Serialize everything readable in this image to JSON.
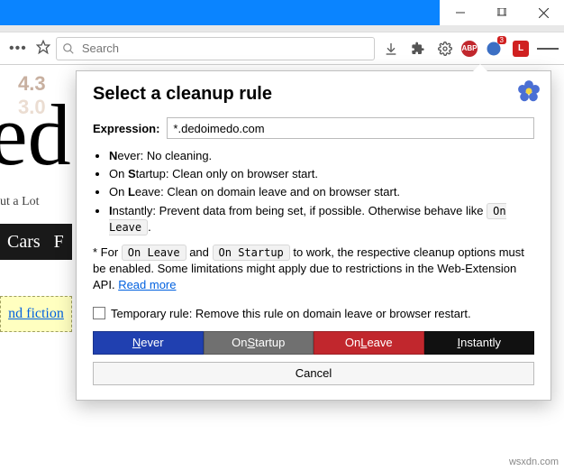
{
  "window": {
    "minimize": "–",
    "maximize": "❐",
    "close": "✕"
  },
  "toolbar": {
    "search_placeholder": "Search",
    "abp": "ABP",
    "notif_count": "3",
    "ext_l": "L"
  },
  "page": {
    "num1": "4.3",
    "num2": "3.0",
    "title_frag": "ed",
    "subtitle": "ut a Lot",
    "nav_cars": "Cars",
    "nav_f": "F",
    "link": "nd fiction"
  },
  "popup": {
    "title": "Select a cleanup rule",
    "expression_label": "Expression:",
    "expression_value": "*.dedoimedo.com",
    "items": {
      "never": "ever: No cleaning.",
      "startup": "tartup: Clean only on browser start.",
      "leave": "eave: Clean on domain leave and on browser start.",
      "instantly": "nstantly: Prevent data from being set, if possible. Otherwise behave like"
    },
    "code_onleave": "On Leave",
    "code_onstartup": "On Startup",
    "note_pre": "* For ",
    "note_mid": " and ",
    "note_post": " to work, the respective cleanup options must be enabled. Some limitations might apply due to restrictions in the Web-Extension API. ",
    "readmore": "Read more",
    "temporary": "Temporary rule: Remove this rule on domain leave or browser restart.",
    "btn_never": "ever",
    "btn_startup": "tartup",
    "btn_leave": "eave",
    "btn_instantly": "nstantly",
    "btn_never_u": "N",
    "btn_startup_pre": "On ",
    "btn_startup_u": "S",
    "btn_leave_pre": "On ",
    "btn_leave_u": "L",
    "btn_instantly_u": "I",
    "cancel": "Cancel"
  },
  "watermark": "wsxdn.com"
}
